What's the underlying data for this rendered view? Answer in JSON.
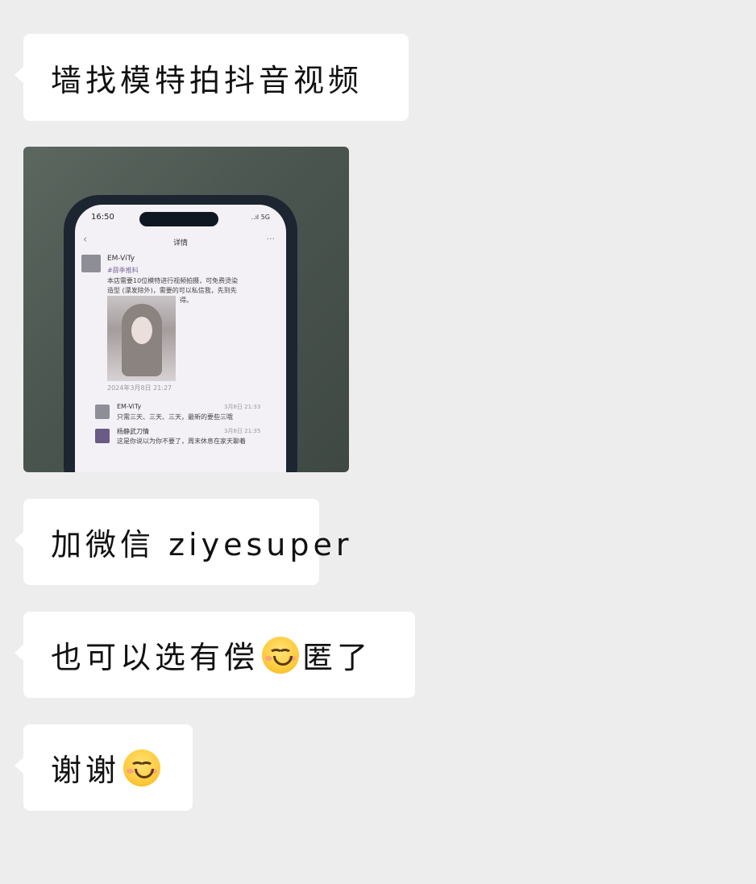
{
  "messages": [
    {
      "type": "text",
      "text": "墙找模特拍抖音视频"
    },
    {
      "type": "image",
      "image": {
        "status_time": "16:50",
        "status_signal": "..ıl 5G",
        "nav_title": "详情",
        "post": {
          "username": "EM-ViTy",
          "tag": "#薛季推料",
          "lines": [
            "本店需要10位模特进行视频拍摄，可免费烫染",
            "造型 (漂发除外)，需要的可以私信我，先到先",
            "得。"
          ],
          "timestamp": "2024年3月8日 21:27"
        },
        "comments": [
          {
            "username": "EM-ViTy",
            "text": "只需三天、三天、三天，最新的要些三哦",
            "time": "3月8日 21:33"
          },
          {
            "username": "杨静武刀情",
            "text": "这是你说以为你不要了，周末休息在家天聊着",
            "time": "3月8日 21:35"
          }
        ]
      }
    },
    {
      "type": "text",
      "text": "加微信 ziyesuper"
    },
    {
      "type": "text",
      "text_before": "也可以选有偿",
      "emoji": "smiling-face-emoji",
      "text_after": "匿了"
    },
    {
      "type": "text",
      "text": "谢谢",
      "emoji": "smiling-face-emoji"
    }
  ],
  "colors": {
    "background": "#ededed",
    "bubble": "#ffffff",
    "text": "#111111"
  }
}
